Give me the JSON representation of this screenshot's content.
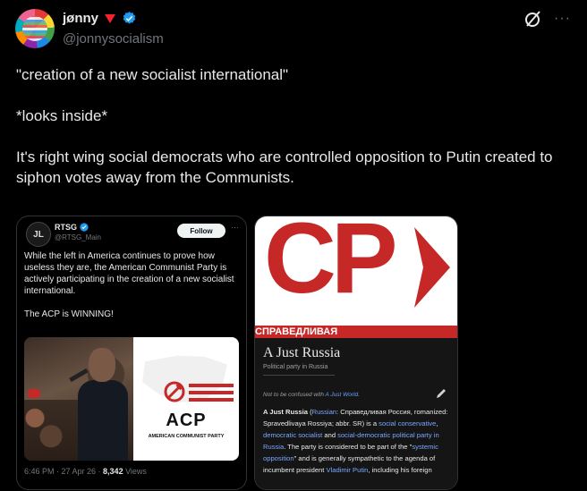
{
  "author": {
    "display_name": "jønny",
    "handle": "@jonnysocialism"
  },
  "icons": {
    "heart": "heart-icon",
    "verified": "verified-icon",
    "grok": "grok-icon",
    "more": "more-icon"
  },
  "colors": {
    "verified": "#1d9bf0",
    "heart": "#f4212e",
    "accent_red": "#c62828"
  },
  "tweet": {
    "line1": "\"creation of a new socialist international\"",
    "line2": "*looks inside*",
    "line3": "It's right wing social democrats who are controlled opposition to Putin created to siphon votes away from the Communists."
  },
  "quoted_left": {
    "avatar_text": "JL",
    "name": "RTSG",
    "handle": "@RTSG_Main",
    "follow_label": "Follow",
    "more": "···",
    "para1": "While the left in America continues to prove how useless they are, the American Communist Party is actively participating in the creation of a new socialist international.",
    "para2": "The ACP is WINNING!",
    "logo_title": "ACP",
    "logo_sub": "AMERICAN COMMUNIST PARTY",
    "time": "6:46 PM · 27 Apr 26 · ",
    "views_count": "8,342",
    "views_label": " Views"
  },
  "quoted_right": {
    "logo_letters": "CP",
    "banner": "СПРАВЕДЛИВАЯ",
    "title": "A Just Russia",
    "subtitle": "Political party in Russia",
    "note_prefix": "Not to be confused with ",
    "note_link": "A Just World",
    "note_suffix": ".",
    "body_bold": "A Just Russia",
    "body_1": " (",
    "body_link1": "Russian",
    "body_2": ": Справедливая Россия, romanized: Spravedlivaya Rossiya; abbr. SR",
    "body_3": ") is a ",
    "body_link2": "social conservative",
    "body_4": ", ",
    "body_link3": "democratic socialist",
    "body_5": " and ",
    "body_link4": "social-democratic",
    "body_link5": "political party in Russia",
    "body_6": ". The party is considered to be part of the \"",
    "body_link6": "systemic opposition",
    "body_7": "\" and is generally sympathetic to the agenda of incumbent president ",
    "body_link7": "Vladimir Putin",
    "body_8": ", including his foreign"
  }
}
